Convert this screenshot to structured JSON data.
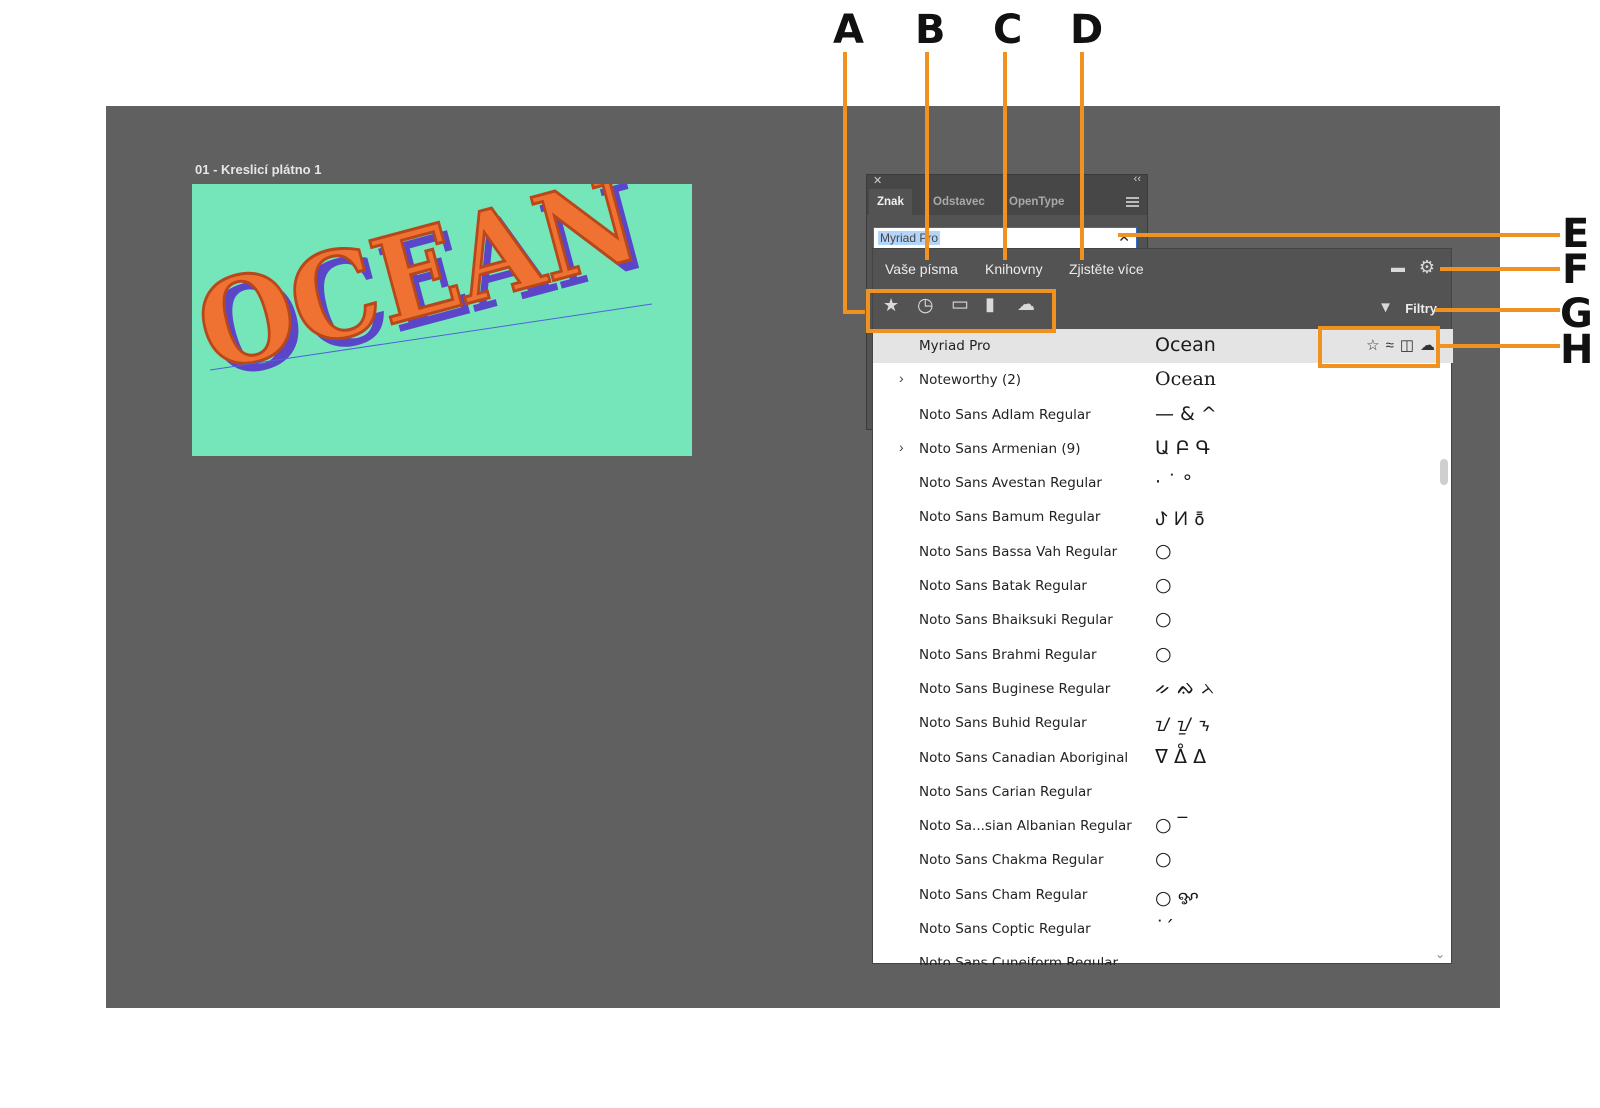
{
  "callouts": [
    "A",
    "B",
    "C",
    "D",
    "E",
    "F",
    "G",
    "H"
  ],
  "artboard": {
    "label": "01 - Kreslicí plátno 1",
    "artwork_text": "OCEAN",
    "background_color": "#75e6b9",
    "text_color": "#f07232",
    "shadow_color": "#5b45c8"
  },
  "char_panel": {
    "tabs": [
      "Znak",
      "Odstavec",
      "OpenType"
    ],
    "search_value": "Myriad Pro",
    "clear_icon": "close-icon"
  },
  "font_popup": {
    "tabs": [
      "Vaše písma",
      "Knihovny",
      "Zjistěte více"
    ],
    "filter_label": "Filtry",
    "filter_icons": [
      "star-icon",
      "clock-icon",
      "monitor-icon",
      "document-icon",
      "cloud-icon"
    ],
    "row_actions": [
      "☆",
      "≈",
      "◫",
      "☁"
    ],
    "fonts": [
      {
        "name": "Myriad Pro",
        "sample": "Ocean",
        "selected": true,
        "expand": ""
      },
      {
        "name": "Noteworthy (2)",
        "sample": "Ocean",
        "expand": "›"
      },
      {
        "name": "Noto Sans Adlam Regular",
        "sample": "— & ^",
        "expand": ""
      },
      {
        "name": "Noto Sans Armenian (9)",
        "sample": "Ա Բ Գ",
        "expand": "›"
      },
      {
        "name": "Noto Sans Avestan Regular",
        "sample": "· ˙ °",
        "expand": ""
      },
      {
        "name": "Noto Sans Bamum Regular",
        "sample": "ꚠ ꚡ ꚢ",
        "expand": ""
      },
      {
        "name": "Noto Sans Bassa Vah Regular",
        "sample": "○",
        "expand": ""
      },
      {
        "name": "Noto Sans Batak Regular",
        "sample": "○",
        "expand": ""
      },
      {
        "name": "Noto Sans Bhaiksuki Regular",
        "sample": "○",
        "expand": ""
      },
      {
        "name": "Noto Sans Brahmi Regular",
        "sample": "○",
        "expand": ""
      },
      {
        "name": "Noto Sans Buginese Regular",
        "sample": "ᨀ ᨁ ᨂ",
        "expand": ""
      },
      {
        "name": "Noto Sans Buhid Regular",
        "sample": "ᝀ ᝁ ᝂ",
        "expand": ""
      },
      {
        "name": "Noto Sans Canadian Aboriginal",
        "sample": "ᐁ ᐂ ᐃ",
        "expand": ""
      },
      {
        "name": "Noto Sans Carian Regular",
        "sample": "",
        "expand": ""
      },
      {
        "name": "Noto Sa...sian Albanian Regular",
        "sample": "○ ‾",
        "expand": ""
      },
      {
        "name": "Noto Sans Chakma Regular",
        "sample": "○",
        "expand": ""
      },
      {
        "name": "Noto Sans Cham Regular",
        "sample": "○ ꨀ",
        "expand": ""
      },
      {
        "name": "Noto Sans Coptic Regular",
        "sample": "˙ˊ",
        "expand": ""
      },
      {
        "name": "Noto Sans Cuneiform Regular",
        "sample": "",
        "expand": ""
      }
    ]
  },
  "colors": {
    "callout": "#f0921f",
    "workspace": "#606060",
    "panel": "#535353"
  }
}
